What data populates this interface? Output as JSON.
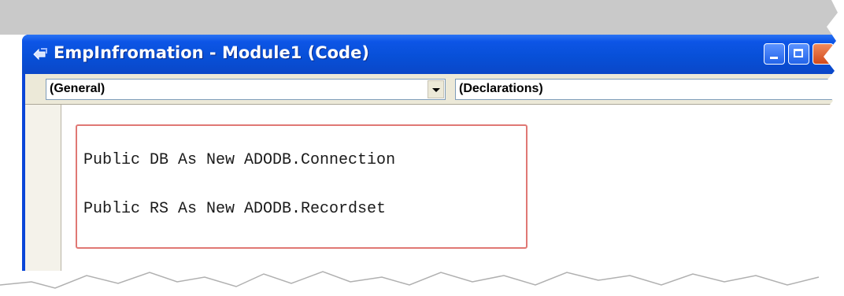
{
  "window": {
    "title": "EmpInfromation - Module1 (Code)"
  },
  "dropdowns": {
    "object": {
      "value": "(General)"
    },
    "procedure": {
      "value": "(Declarations)"
    }
  },
  "code": {
    "lines": [
      "Public DB As New ADODB.Connection",
      "Public RS As New ADODB.Recordset"
    ]
  },
  "colors": {
    "titlebar": "#0a50d8",
    "highlight_border": "#e07874",
    "toolbar": "#ece9d8"
  },
  "icons": {
    "window_icon": "vb-module-icon",
    "minimize": "minimize-icon",
    "maximize": "maximize-icon",
    "dropdown": "chevron-down-icon"
  }
}
